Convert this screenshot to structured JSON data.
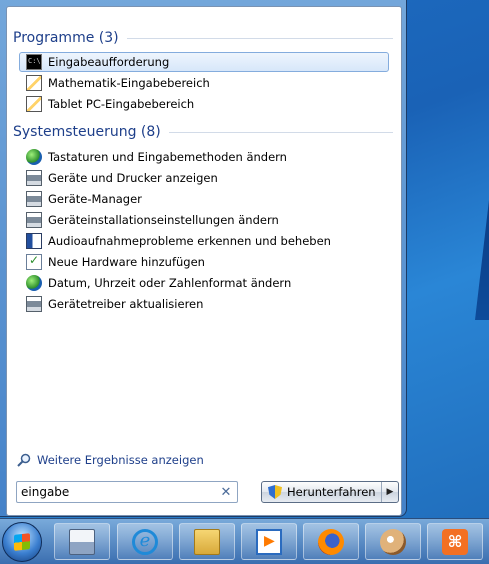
{
  "programs": {
    "title": "Programme (3)",
    "items": [
      {
        "label": "Eingabeaufforderung",
        "icon": "command-prompt-icon",
        "selected": true
      },
      {
        "label": "Mathematik-Eingabebereich",
        "icon": "math-input-icon"
      },
      {
        "label": "Tablet PC-Eingabebereich",
        "icon": "tablet-input-icon"
      }
    ]
  },
  "control_panel": {
    "title": "Systemsteuerung (8)",
    "items": [
      {
        "label": "Tastaturen und Eingabemethoden ändern",
        "icon": "globe-icon"
      },
      {
        "label": "Geräte und Drucker anzeigen",
        "icon": "printer-icon"
      },
      {
        "label": "Geräte-Manager",
        "icon": "printer-icon"
      },
      {
        "label": "Geräteinstallationseinstellungen ändern",
        "icon": "printer-icon"
      },
      {
        "label": "Audioaufnahmeprobleme erkennen und beheben",
        "icon": "audio-icon"
      },
      {
        "label": "Neue Hardware hinzufügen",
        "icon": "hardware-icon"
      },
      {
        "label": "Datum, Uhrzeit oder Zahlenformat ändern",
        "icon": "globe-icon"
      },
      {
        "label": "Gerätetreiber aktualisieren",
        "icon": "printer-icon"
      }
    ]
  },
  "more_results": {
    "label": "Weitere Ergebnisse anzeigen"
  },
  "search": {
    "value": "eingabe"
  },
  "shutdown": {
    "label": "Herunterfahren"
  },
  "taskbar": {
    "items": [
      "keyboard-icon",
      "internet-explorer-icon",
      "file-explorer-icon",
      "media-player-icon",
      "firefox-icon",
      "paint-icon",
      "xampp-icon"
    ]
  }
}
